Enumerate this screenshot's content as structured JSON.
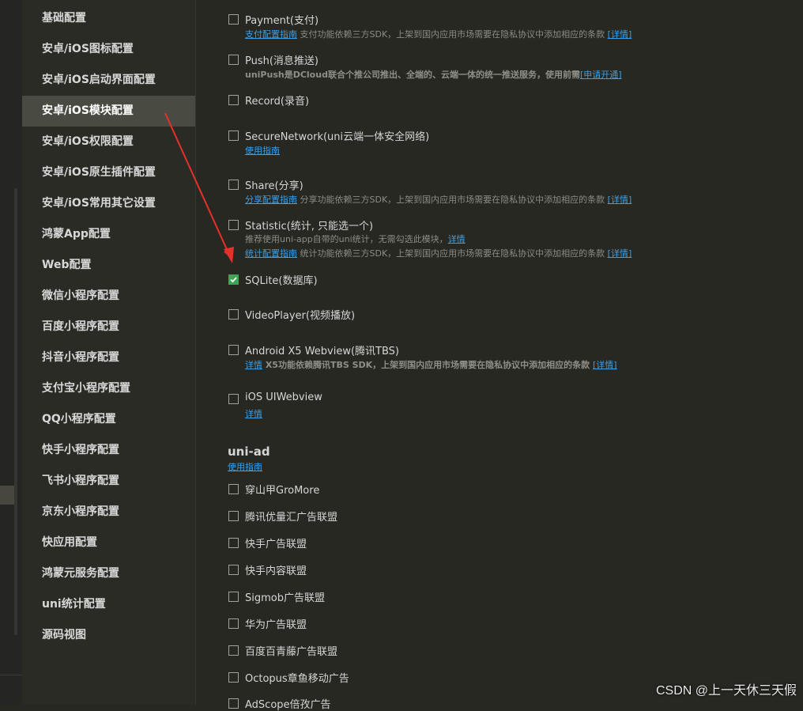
{
  "sidebar": {
    "items": [
      {
        "label": "基础配置"
      },
      {
        "label": "安卓/iOS图标配置"
      },
      {
        "label": "安卓/iOS启动界面配置"
      },
      {
        "label": "安卓/iOS模块配置"
      },
      {
        "label": "安卓/iOS权限配置"
      },
      {
        "label": "安卓/iOS原生插件配置"
      },
      {
        "label": "安卓/iOS常用其它设置"
      },
      {
        "label": "鸿蒙App配置"
      },
      {
        "label": "Web配置"
      },
      {
        "label": "微信小程序配置"
      },
      {
        "label": "百度小程序配置"
      },
      {
        "label": "抖音小程序配置"
      },
      {
        "label": "支付宝小程序配置"
      },
      {
        "label": "QQ小程序配置"
      },
      {
        "label": "快手小程序配置"
      },
      {
        "label": "飞书小程序配置"
      },
      {
        "label": "京东小程序配置"
      },
      {
        "label": "快应用配置"
      },
      {
        "label": "鸿蒙元服务配置"
      },
      {
        "label": "uni统计配置"
      },
      {
        "label": "源码视图"
      }
    ],
    "active_label": "安卓/iOS模块配置"
  },
  "modules": {
    "payment": {
      "label": "Payment(支付)",
      "link": "支付配置指南",
      "text": " 支付功能依赖三方SDK，上架到国内应用市场需要在隐私协议中添加相应的条款 ",
      "detail": "[详情]"
    },
    "push": {
      "label": "Push(消息推送)",
      "bold": "uniPush是DCloud联合个推公司推出、全端的、云端一体的统一推送服务，使用前需",
      "link": "[申请开通]"
    },
    "record": {
      "label": "Record(录音)"
    },
    "securenetwork": {
      "label": "SecureNetwork(uni云端一体安全网络)",
      "link": "使用指南"
    },
    "share": {
      "label": "Share(分享)",
      "link": "分享配置指南",
      "text": " 分享功能依赖三方SDK，上架到国内应用市场需要在隐私协议中添加相应的条款 ",
      "detail": "[详情]"
    },
    "statistic": {
      "label": "Statistic(统计, 只能选一个)",
      "note": "推荐使用uni-app自带的uni统计，无需勾选此模块，",
      "note_link": "详情",
      "link": "统计配置指南",
      "text": " 统计功能依赖三方SDK，上架到国内应用市场需要在隐私协议中添加相应的条款 ",
      "detail": "[详情]"
    },
    "sqlite": {
      "label": "SQLite(数据库)",
      "checked": true
    },
    "videoplayer": {
      "label": "VideoPlayer(视频播放)"
    },
    "x5": {
      "label": "Android X5 Webview(腾讯TBS)",
      "link": "详情",
      "text": " X5功能依赖腾讯TBS SDK，上架到国内应用市场需要在隐私协议中添加相应的条款 ",
      "detail": "[详情]"
    },
    "uiwebview": {
      "label": "iOS UIWebview",
      "link": "详情"
    }
  },
  "uniad": {
    "title": "uni-ad",
    "guide_link": "使用指南",
    "items": [
      {
        "label": "穿山甲GroMore"
      },
      {
        "label": "腾讯优量汇广告联盟"
      },
      {
        "label": "快手广告联盟"
      },
      {
        "label": "快手内容联盟"
      },
      {
        "label": "Sigmob广告联盟"
      },
      {
        "label": "华为广告联盟"
      },
      {
        "label": "百度百青藤广告联盟"
      },
      {
        "label": "Octopus章鱼移动广告"
      },
      {
        "label": "AdScope倍孜广告"
      }
    ]
  },
  "colors": {
    "checked": "#3ea555",
    "link": "#3b9fe6",
    "arrow": "#e8302a"
  },
  "watermark": "CSDN @上一天休三天假"
}
